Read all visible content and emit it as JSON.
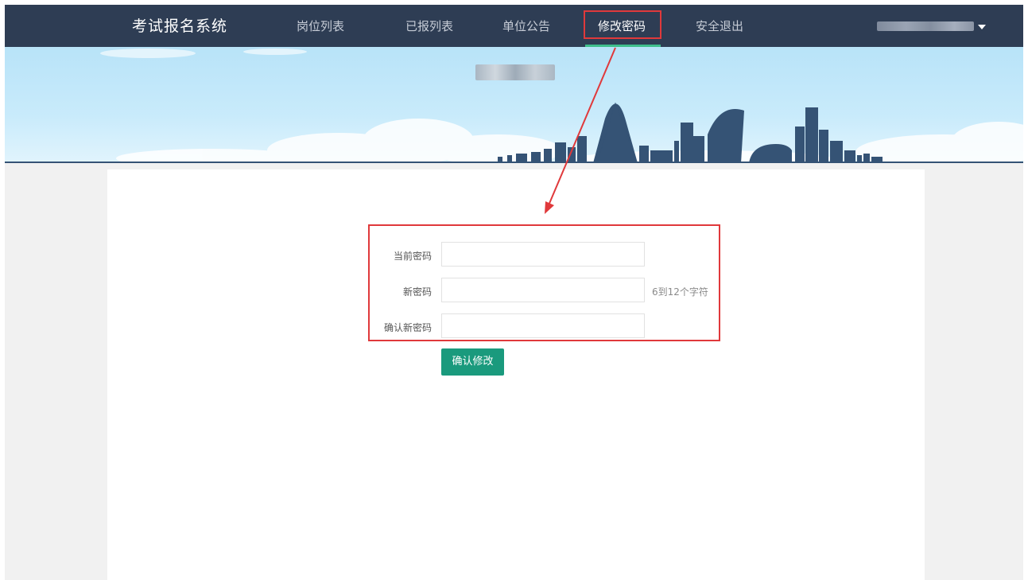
{
  "nav": {
    "brand": "考试报名系统",
    "items": [
      {
        "label": "岗位列表"
      },
      {
        "label": "已报列表"
      },
      {
        "label": "单位公告"
      },
      {
        "label": "修改密码"
      },
      {
        "label": "安全退出"
      }
    ],
    "active_index": 3
  },
  "form": {
    "current_password_label": "当前密码",
    "new_password_label": "新密码",
    "new_password_hint": "6到12个字符",
    "confirm_password_label": "确认新密码",
    "submit_label": "确认修改"
  },
  "colors": {
    "navbar": "#2e3d54",
    "accent": "#1a9a7d",
    "annotation": "#e0393b",
    "nav_underline": "#3fbf8c"
  }
}
